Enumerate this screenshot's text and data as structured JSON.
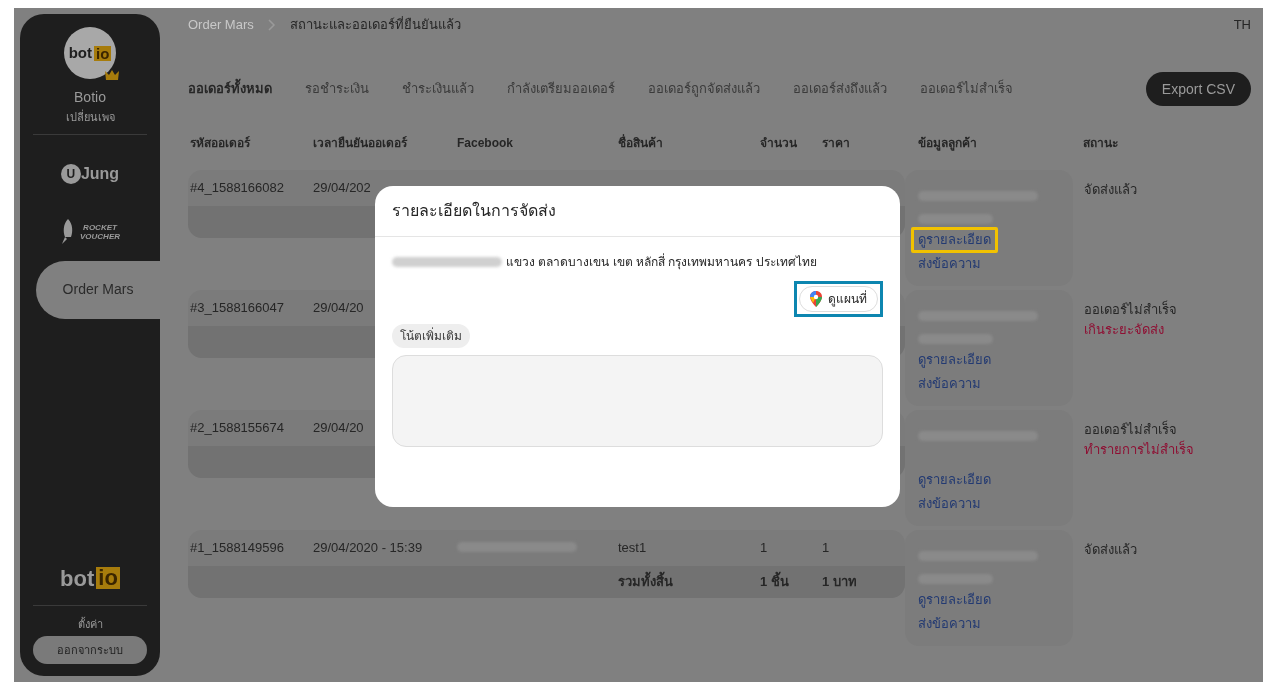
{
  "sidebar": {
    "logo": {
      "left": "bot",
      "right": "io"
    },
    "account_name": "Botio",
    "switch_page": "เปลี่ยนเพจ",
    "apps": [
      {
        "kind": "ujung",
        "badge": "U",
        "label": "Jung",
        "selected": false
      },
      {
        "kind": "rocket",
        "label": "ROCKET VOUCHER",
        "selected": false
      },
      {
        "kind": "text",
        "label": "Order Mars",
        "selected": true
      }
    ],
    "bottom_logo": {
      "left": "bot",
      "right": "io"
    },
    "settings": "ตั้งค่า",
    "logout": "ออกจากระบบ"
  },
  "breadcrumb": {
    "parent": "Order Mars",
    "current": "สถานะและออเดอร์ที่ยืนยันแล้ว"
  },
  "language": "TH",
  "tabs": [
    {
      "label": "ออเดอร์ทั้งหมด",
      "selected": true
    },
    {
      "label": "รอชำระเงิน",
      "selected": false
    },
    {
      "label": "ชำระเงินแล้ว",
      "selected": false
    },
    {
      "label": "กำลังเตรียมออเดอร์",
      "selected": false
    },
    {
      "label": "ออเดอร์ถูกจัดส่งแล้ว",
      "selected": false
    },
    {
      "label": "ออเดอร์ส่งถึงแล้ว",
      "selected": false
    },
    {
      "label": "ออเดอร์ไม่สำเร็จ",
      "selected": false
    }
  ],
  "export_button": "Export CSV",
  "table": {
    "columns": [
      "รหัสออเดอร์",
      "เวลายืนยันออเดอร์",
      "Facebook",
      "ชื่อสินค้า",
      "จำนวน",
      "ราคา",
      "ข้อมูลลูกค้า",
      "สถานะ"
    ],
    "rows": [
      {
        "order_id": "#4_1588166082",
        "time": "29/04/202",
        "facebook_redacted": false,
        "name_redacted": true,
        "phone_redacted": true,
        "detail_link": "ดูรายละเอียด",
        "detail_highlighted": true,
        "message_link": "ส่งข้อความ",
        "status": "จัดส่งแล้ว"
      },
      {
        "order_id": "#3_1588166047",
        "time": "29/04/20",
        "facebook_redacted": false,
        "name_redacted": true,
        "phone_redacted": true,
        "detail_link": "ดูรายละเอียด",
        "detail_highlighted": false,
        "message_link": "ส่งข้อความ",
        "status": "ออเดอร์ไม่สำเร็จ",
        "reason": "เกินระยะจัดส่ง"
      },
      {
        "order_id": "#2_1588155674",
        "time": "29/04/20",
        "facebook_redacted": false,
        "name_redacted": true,
        "phone_redacted": false,
        "detail_link": "ดูรายละเอียด",
        "detail_highlighted": false,
        "message_link": "ส่งข้อความ",
        "status": "ออเดอร์ไม่สำเร็จ",
        "reason": "ทำรายการไม่สำเร็จ"
      },
      {
        "order_id": "#1_1588149596",
        "time": "29/04/2020 - 15:39",
        "facebook_redacted": true,
        "product": "test1",
        "qty": "1",
        "price": "1",
        "total_label": "รวมทั้งสิ้น",
        "total_qty": "1 ชิ้น",
        "total_price": "1 บาท",
        "name_redacted": true,
        "phone_redacted": true,
        "detail_link": "ดูรายละเอียด",
        "detail_highlighted": false,
        "message_link": "ส่งข้อความ",
        "status": "จัดส่งแล้ว"
      }
    ]
  },
  "modal": {
    "title": "รายละเอียดในการจัดส่ง",
    "address_redacted": true,
    "address": "แขวง ตลาดบางเขน เขต หลักสี่ กรุงเทพมหานคร ประเทศไทย",
    "map_button": "ดูแผนที่",
    "map_highlighted": true,
    "note_label": "โน้ตเพิ่มเติม"
  }
}
